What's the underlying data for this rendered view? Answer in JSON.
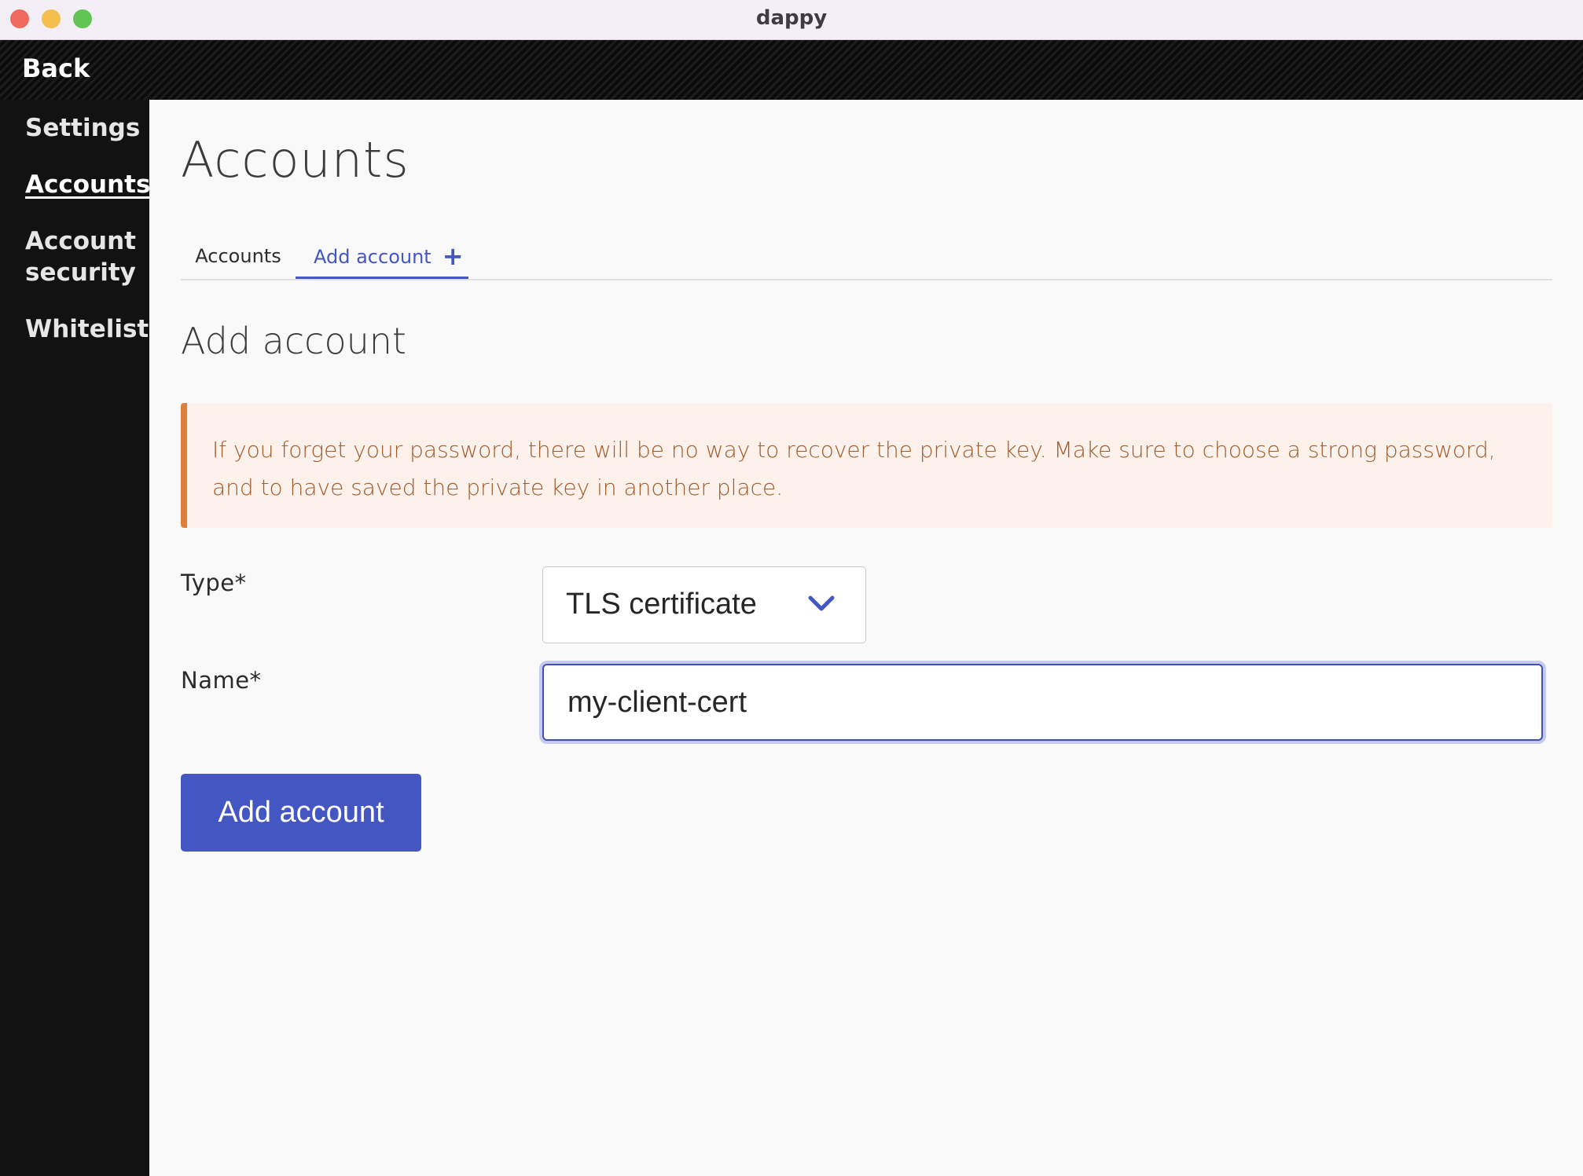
{
  "window": {
    "title": "dappy"
  },
  "topbar": {
    "back_label": "Back"
  },
  "sidebar": {
    "items": [
      {
        "label": "Settings",
        "active": false
      },
      {
        "label": "Accounts",
        "active": true
      },
      {
        "label": "Account security",
        "active": false
      },
      {
        "label": "Whitelist",
        "active": false
      }
    ]
  },
  "main": {
    "title": "Accounts",
    "tabs": [
      {
        "label": "Accounts",
        "active": false
      },
      {
        "label": "Add account",
        "icon": "plus-icon",
        "active": true
      }
    ],
    "section_title": "Add account",
    "alert": {
      "text": "If you forget your password, there will be no way to recover the private key. Make sure to choose a strong password, and to have saved the private key in another place."
    },
    "form": {
      "type_label": "Type*",
      "type_value": "TLS certificate",
      "name_label": "Name*",
      "name_value": "my-client-cert",
      "submit_label": "Add account"
    }
  },
  "colors": {
    "accent": "#4356c1",
    "sidebar_bg": "#121212",
    "alert_bg": "#fcf1eb",
    "alert_border": "#e07e3c",
    "alert_text": "#a35a2a"
  }
}
